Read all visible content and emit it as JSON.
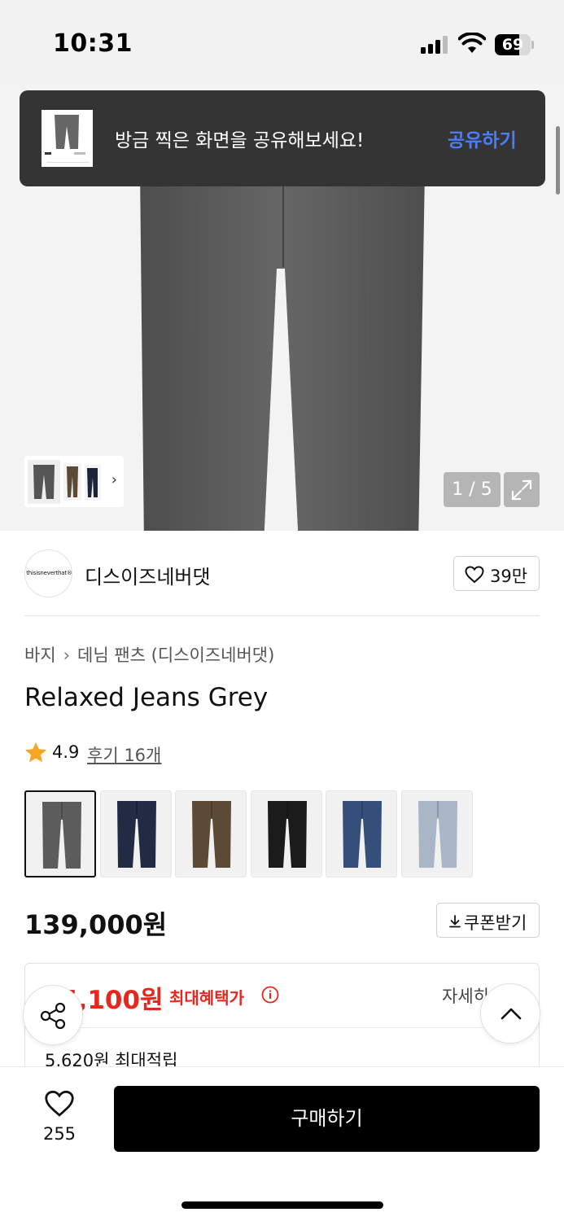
{
  "status_bar": {
    "time": "10:31",
    "battery_level": "69",
    "battery_fraction": 0.69
  },
  "toast": {
    "message": "방금 찍은 화면을 공유해보세요!",
    "action_label": "공유하기"
  },
  "gallery": {
    "page_indicator": "1 / 5",
    "main_color": "#5e5e5e"
  },
  "brand": {
    "logo_text": "thisisneverthat®",
    "name": "디스이즈네버댓",
    "like_count": "39만"
  },
  "breadcrumb": {
    "items": [
      "바지",
      "데님 팬츠 (디스이즈네버댓)"
    ]
  },
  "product": {
    "title": "Relaxed Jeans Grey",
    "rating": "4.9",
    "review_label": "후기 16개",
    "price": "139,000원",
    "coupon_label": "쿠폰받기",
    "color_options": [
      {
        "name": "grey",
        "color": "#5c5c5c",
        "selected": true
      },
      {
        "name": "navy",
        "color": "#222a44",
        "selected": false
      },
      {
        "name": "brown",
        "color": "#5b4a36",
        "selected": false
      },
      {
        "name": "black",
        "color": "#1b1b1b",
        "selected": false
      },
      {
        "name": "blue",
        "color": "#34507a",
        "selected": false
      },
      {
        "name": "light-blue",
        "color": "#a9b6c6",
        "selected": false
      }
    ]
  },
  "benefit": {
    "max_price": "5,100원",
    "max_price_label": "최대혜택가",
    "detail_label": "자세히",
    "points": "5,620원 최대적립"
  },
  "bottom_bar": {
    "like_count": "255",
    "buy_label": "구매하기"
  },
  "colors": {
    "accent_blue": "#4a7df7",
    "sale_red": "#e8261c",
    "star": "#f5a623"
  }
}
